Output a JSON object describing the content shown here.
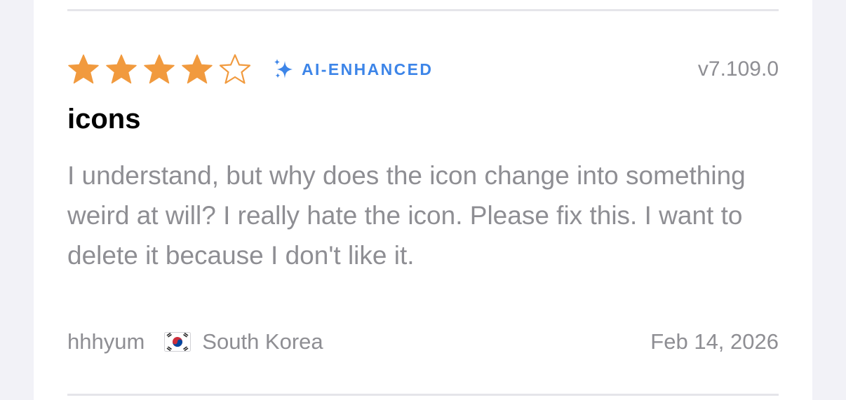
{
  "review": {
    "rating": 4,
    "max_rating": 5,
    "badge_label": "AI-ENHANCED",
    "version": "v7.109.0",
    "title": "icons",
    "body": "I understand, but why does the icon change into something weird at will? I really hate the icon. Please fix this. I want to delete it because I don't like it.",
    "author": "hhhyum",
    "country": "South Korea",
    "country_flag_icon": "south-korea-flag-icon",
    "date": "Feb 14, 2026"
  },
  "icons": {
    "star_filled": "star-filled-icon",
    "star_empty": "star-outline-icon",
    "sparkle": "sparkle-icon"
  },
  "colors": {
    "star": "#f19a3e",
    "badge": "#3d85e8",
    "secondary_text": "#8e8e93",
    "title_text": "#000000",
    "divider": "#e5e5ea"
  }
}
